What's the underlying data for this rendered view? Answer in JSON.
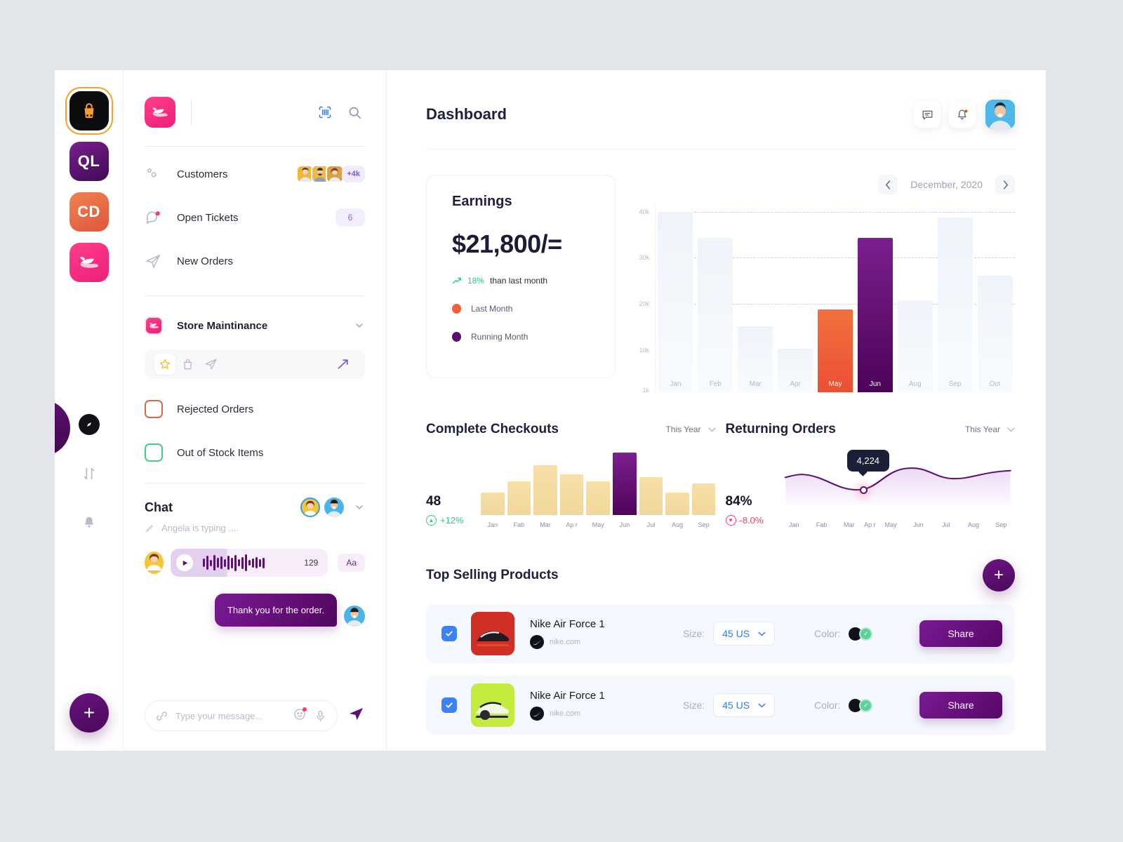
{
  "rail": {
    "apps": [
      {
        "name": "shop-app",
        "label": "",
        "selected": true
      },
      {
        "name": "ql-app",
        "label": "QL",
        "selected": false
      },
      {
        "name": "cd-app",
        "label": "CD",
        "selected": false
      },
      {
        "name": "whale-app",
        "label": "",
        "selected": false
      }
    ],
    "icons": [
      "compass-icon",
      "sort-icon",
      "bell-icon"
    ],
    "fab_label": "+"
  },
  "sidebar": {
    "logo": "whale-logo",
    "scan_icon": "barcode-scan-icon",
    "search_icon": "search-icon",
    "nav": [
      {
        "label": "Customers",
        "icon": "customers-icon",
        "avatars_more": "+4k"
      },
      {
        "label": "Open Tickets",
        "icon": "ticket-chat-icon",
        "count": "6"
      },
      {
        "label": "New Orders",
        "icon": "paper-plane-icon"
      }
    ],
    "section": {
      "label": "Store Maintinance",
      "icon": "whale-logo",
      "chevron": "chevron-down-icon"
    },
    "quickbar": [
      "star-icon",
      "bag-icon",
      "paper-plane-icon",
      "trend-up-icon"
    ],
    "checks": [
      {
        "label": "Rejected Orders",
        "color": "#d96a44"
      },
      {
        "label": "Out of Stock Items",
        "color": "#4cc98a"
      }
    ],
    "chat": {
      "title": "Chat",
      "typing": "Angela is typing ....",
      "typing_icon": "pencil-icon",
      "chevron": "chevron-down-icon",
      "voice": {
        "duration": "129",
        "play_icon": "play-icon",
        "format_label": "Aa"
      },
      "outgoing": "Thank you for the order.",
      "input_placeholder": "Type your message...",
      "input_icons": [
        "link-icon",
        "emoji-icon",
        "microphone-icon",
        "send-icon"
      ]
    }
  },
  "header": {
    "title": "Dashboard",
    "icons": [
      "message-icon",
      "bell-notification-icon"
    ],
    "avatar": "user-avatar"
  },
  "earnings": {
    "title": "Earnings",
    "value": "$21,800/=",
    "delta_pct": "18%",
    "delta_text": "than last month",
    "delta_icon": "trend-up-arrow-icon",
    "legend": [
      {
        "label": "Last Month",
        "color": "#f0603a"
      },
      {
        "label": "Running Month",
        "color": "#5c0f72"
      }
    ]
  },
  "month_nav": {
    "prev": "chevron-left-icon",
    "label": "December, 2020",
    "next": "chevron-right-icon"
  },
  "products_section": {
    "title": "Top Selling Products",
    "add_label": "+"
  },
  "products": [
    {
      "checked": true,
      "name": "Nike Air Force 1",
      "domain": "nike.com",
      "brand_icon": "nike-swoosh-icon",
      "image": "red-sneaker",
      "size_label": "Size:",
      "size_value": "45 US",
      "color_label": "Color:",
      "colors": [
        "#111118",
        "#5ed19a"
      ],
      "selected_color_index": 1,
      "share_label": "Share"
    },
    {
      "checked": true,
      "name": "Nike Air Force 1",
      "domain": "nike.com",
      "brand_icon": "nike-swoosh-icon",
      "image": "green-sneaker",
      "size_label": "Size:",
      "size_value": "45 US",
      "color_label": "Color:",
      "colors": [
        "#111118",
        "#5ed19a"
      ],
      "selected_color_index": 1,
      "share_label": "Share"
    }
  ],
  "chart_data": [
    {
      "type": "bar",
      "title": "Earnings",
      "categories": [
        "Jan",
        "Feb",
        "Mar",
        "Apr",
        "May",
        "Jun",
        "Aug",
        "Sep",
        "Oct"
      ],
      "values": [
        40000,
        34500,
        15000,
        10000,
        18500,
        34500,
        20500,
        39000,
        26000
      ],
      "highlight": {
        "May": "#f0603a",
        "Jun": "#5c0f72"
      },
      "ylabel": "",
      "xlabel": "",
      "yticks": [
        "40k",
        "30k",
        "20k",
        "10k",
        "1k"
      ],
      "ylim": [
        1000,
        41000
      ],
      "grid": true,
      "legend": [
        "Last Month",
        "Running Month"
      ]
    },
    {
      "type": "bar",
      "title": "Complete Checkouts",
      "range_label": "This Year",
      "stat_value": "48",
      "stat_change": "+12%",
      "stat_direction": "up",
      "categories": [
        "Jan",
        "Fab",
        "Mar",
        "Ap r",
        "May",
        "Jun",
        "Jul",
        "Aug",
        "Sep"
      ],
      "values": [
        30,
        44,
        66,
        54,
        44,
        82,
        50,
        30,
        42
      ],
      "highlight_index": 5,
      "bar_color": "#f5daa1",
      "highlight_color": "#5c0f72",
      "ylim": [
        0,
        100
      ]
    },
    {
      "type": "area",
      "title": "Returning Orders",
      "range_label": "This Year",
      "stat_value": "84%",
      "stat_change": "-8.0%",
      "stat_direction": "down",
      "categories": [
        "Jan",
        "Fab",
        "Mar",
        "Ap r",
        "May",
        "Jun",
        "Jul",
        "Aug",
        "Sep"
      ],
      "values": [
        4400,
        4224,
        3400,
        3350,
        4600,
        5400,
        5100,
        4950,
        5300
      ],
      "annotation": {
        "label": "4,224",
        "at_category": "Fab",
        "value": 4224
      },
      "line_color": "#5c0f72",
      "fill_color": "#f3e6fa"
    }
  ]
}
